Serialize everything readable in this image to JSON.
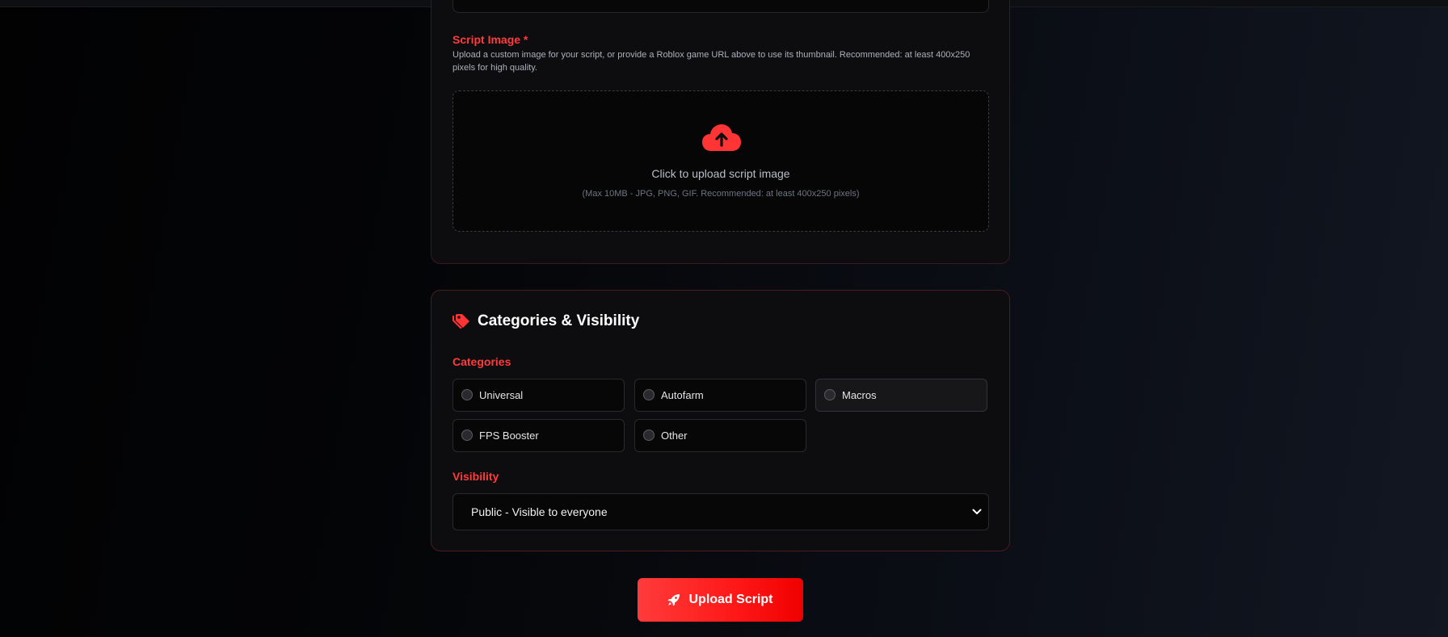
{
  "script_image": {
    "label": "Script Image *",
    "help": "Upload a custom image for your script, or provide a Roblox game URL above to use its thumbnail. Recommended: at least 400x250 pixels for high quality.",
    "dropzone": {
      "icon": "cloud-upload-icon",
      "title": "Click to upload script image",
      "hint": "(Max 10MB - JPG, PNG, GIF. Recommended: at least 400x250 pixels)"
    }
  },
  "categories_section": {
    "icon": "tags-icon",
    "title": "Categories & Visibility",
    "categories_label": "Categories",
    "options": [
      {
        "label": "Universal",
        "selected": false
      },
      {
        "label": "Autofarm",
        "selected": false
      },
      {
        "label": "Macros",
        "selected": false
      },
      {
        "label": "FPS Booster",
        "selected": false
      },
      {
        "label": "Other",
        "selected": false
      }
    ],
    "visibility_label": "Visibility",
    "visibility_value": "Public - Visible to everyone"
  },
  "submit": {
    "icon": "rocket-icon",
    "label": "Upload Script"
  },
  "colors": {
    "accent": "#ff2a2a",
    "background": "#050608",
    "card": "#0d0d0f"
  }
}
